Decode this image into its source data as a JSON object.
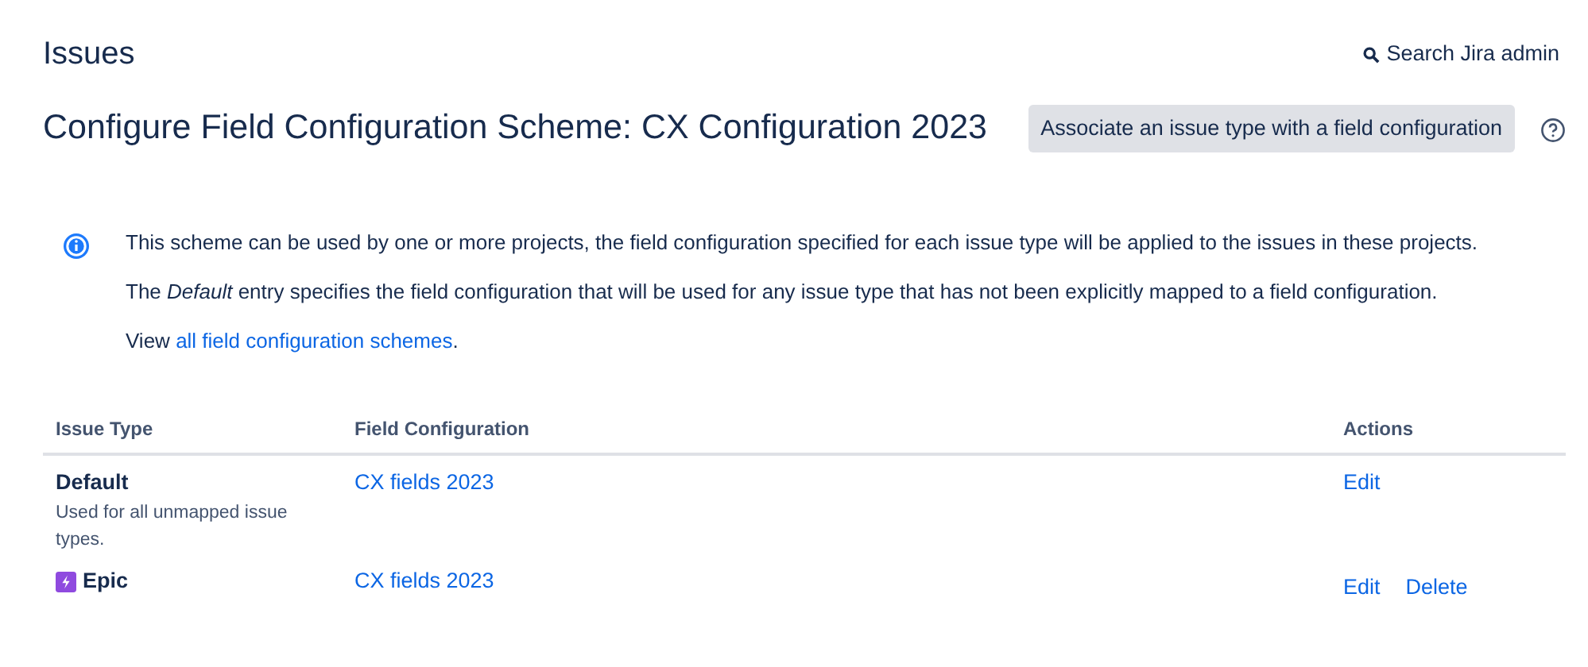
{
  "page_title": "Issues",
  "admin_search": {
    "label": "Search Jira admin"
  },
  "heading": "Configure Field Configuration Scheme: CX Configuration 2023",
  "associate_button": "Associate an issue type with a field configuration",
  "info": {
    "paragraphs": [
      "This scheme can be used by one or more projects, the field configuration specified for each issue type will be applied to the issues in these projects.",
      "The *Default* entry specifies the field configuration that will be used for any issue type that has not been explicitly mapped to a field configuration."
    ],
    "view_text": "View",
    "view_link": "all field configuration schemes",
    "view_end": "."
  },
  "table": {
    "columns": [
      "Issue Type",
      "Field Configuration",
      "Actions"
    ],
    "rows": [
      {
        "kind": "default",
        "issue_type": "Default",
        "description": "Used for all unmapped issue types.",
        "field_configuration": "CX fields 2023",
        "actions": [
          "Edit"
        ]
      },
      {
        "kind": "epic",
        "issue_type": "Epic",
        "field_configuration": "CX fields 2023",
        "actions": [
          "Edit",
          "Delete"
        ]
      }
    ]
  }
}
